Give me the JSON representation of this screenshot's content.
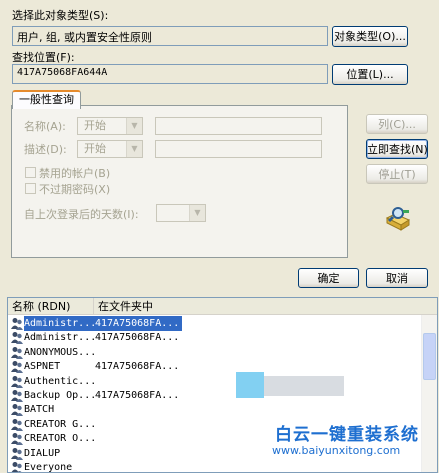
{
  "object_type": {
    "label": "选择此对象类型(S):",
    "value": "用户, 组, 或内置安全性原则",
    "button": "对象类型(O)..."
  },
  "location": {
    "label": "查找位置(F):",
    "value": "417A75068FA644A",
    "button": "位置(L)..."
  },
  "query": {
    "tab": "一般性查询",
    "name_label": "名称(A):",
    "name_mode": "开始",
    "desc_label": "描述(D):",
    "desc_mode": "开始",
    "disabled_accounts": "禁用的帐户(B)",
    "non_expiring_pwd": "不过期密码(X)",
    "days_since_logon": "自上次登录后的天数(I):"
  },
  "side_buttons": {
    "columns": "列(C)...",
    "find_now": "立即查找(N)",
    "stop": "停止(T)"
  },
  "dialog_buttons": {
    "ok": "确定",
    "cancel": "取消"
  },
  "results": {
    "columns": [
      "名称 (RDN)",
      "在文件夹中"
    ],
    "rows": [
      {
        "name": "Administr...",
        "folder": "417A75068FA...",
        "selected": true
      },
      {
        "name": "Administr...",
        "folder": "417A75068FA...",
        "selected": false
      },
      {
        "name": "ANONYMOUS...",
        "folder": "",
        "selected": false
      },
      {
        "name": "ASPNET",
        "folder": "417A75068FA...",
        "selected": false
      },
      {
        "name": "Authentic...",
        "folder": "",
        "selected": false
      },
      {
        "name": "Backup Op...",
        "folder": "417A75068FA...",
        "selected": false
      },
      {
        "name": "BATCH",
        "folder": "",
        "selected": false
      },
      {
        "name": "CREATOR G...",
        "folder": "",
        "selected": false
      },
      {
        "name": "CREATOR O...",
        "folder": "",
        "selected": false
      },
      {
        "name": "DIALUP",
        "folder": "",
        "selected": false
      },
      {
        "name": "Everyone",
        "folder": "",
        "selected": false
      }
    ]
  },
  "watermark": {
    "title": "白云一键重装系统",
    "url": "www.baiyunxitong.com"
  },
  "colors": {
    "selection": "#316ac5",
    "dialog_bg": "#ece9d8",
    "tab_accent": "#e68b2c",
    "watermark_blue": "#1e6fd0"
  }
}
